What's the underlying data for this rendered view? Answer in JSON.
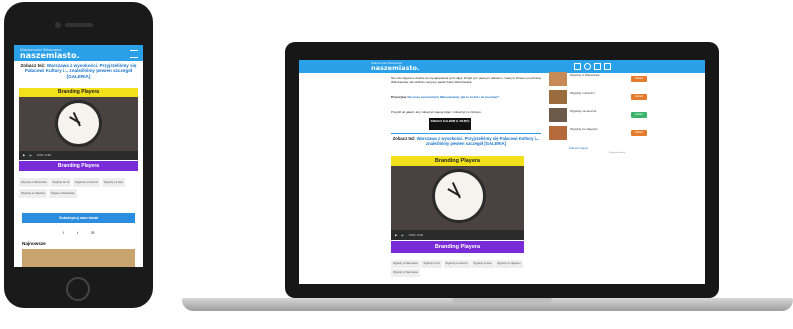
{
  "site": {
    "brand_small": "Wiadomości Warszawa",
    "brand": "naszemiasto.",
    "nav": [
      "Wiadomości",
      "Kronika",
      "Sport",
      "Zdjęcia",
      "Ruch",
      "Rzeczy",
      "Sklep",
      "Więcej"
    ]
  },
  "article": {
    "paragraph1": "Nie robi zdjęcia w drodze do wynajdywania tych zdjęć. Dzięki tym pięknym widokom, zwanym zbiorem pod Kartą Warszawską, tak widzicie wszyscy pasaż Kartę Warszawską.",
    "przeczytaj_prefix": "Przeczytaj:",
    "przeczytaj_link": "Na mocy zwrotu Karty Warszawskiej, jak to zrobić i ile kosztuje?",
    "paragraph2": "Przejdź do galerii, aby zobaczyć więcej zdjęć i zobaczyć co złożono.",
    "gallery_button": "ZOBACZ GALERIĘ (1 ZDJĘĆ)",
    "zobacz_prefix": "Zobacz też:",
    "zobacz_link": "Warszawa z wysokości. Przyjrzeliśmy się Pałacowi Kultury i... znaleźliśmy pewien szczegół [GALERIA]",
    "video_banner": "Branding Playera",
    "video_time": "0:00 / 0:26",
    "purple_banner": "Branding Playera",
    "tags": [
      "Wyjazdy w Warszawie",
      "Wyjazdy do 10",
      "Wyjazdy na wieczór",
      "Wyjazdy na dwa",
      "Wyjazdy ze zdjęciem",
      "Święta w Warszawie",
      "Wyjazdy w Warszawie"
    ]
  },
  "phone": {
    "subscribe_button": "Subskrybuj nasz kanał",
    "share_icons": [
      "facebook-icon",
      "twitter-icon",
      "mail-icon"
    ],
    "section_heading": "Najnowsze"
  },
  "sidebar": {
    "items": [
      {
        "title": "Wyjazdy w Warszawie",
        "button": "zobacz",
        "color": "#e57b2c"
      },
      {
        "title": "Wyjazdy z dziećmi",
        "button": "zobacz",
        "color": "#e57b2c"
      },
      {
        "title": "Wyjazdy na wieczór",
        "button": "zobacz",
        "color": "#3ab36b"
      },
      {
        "title": "Wyjazdy ze zdjęciem",
        "button": "zobacz",
        "color": "#e57b2c"
      }
    ],
    "more_link": "Zobacz więcej",
    "footnote": "Wszystkie oferty"
  },
  "colors": {
    "header": "#29a0e8",
    "brand_purple": "#7a2bd8",
    "banner_yellow": "#f2e01b",
    "link_blue": "#1a73c8"
  }
}
